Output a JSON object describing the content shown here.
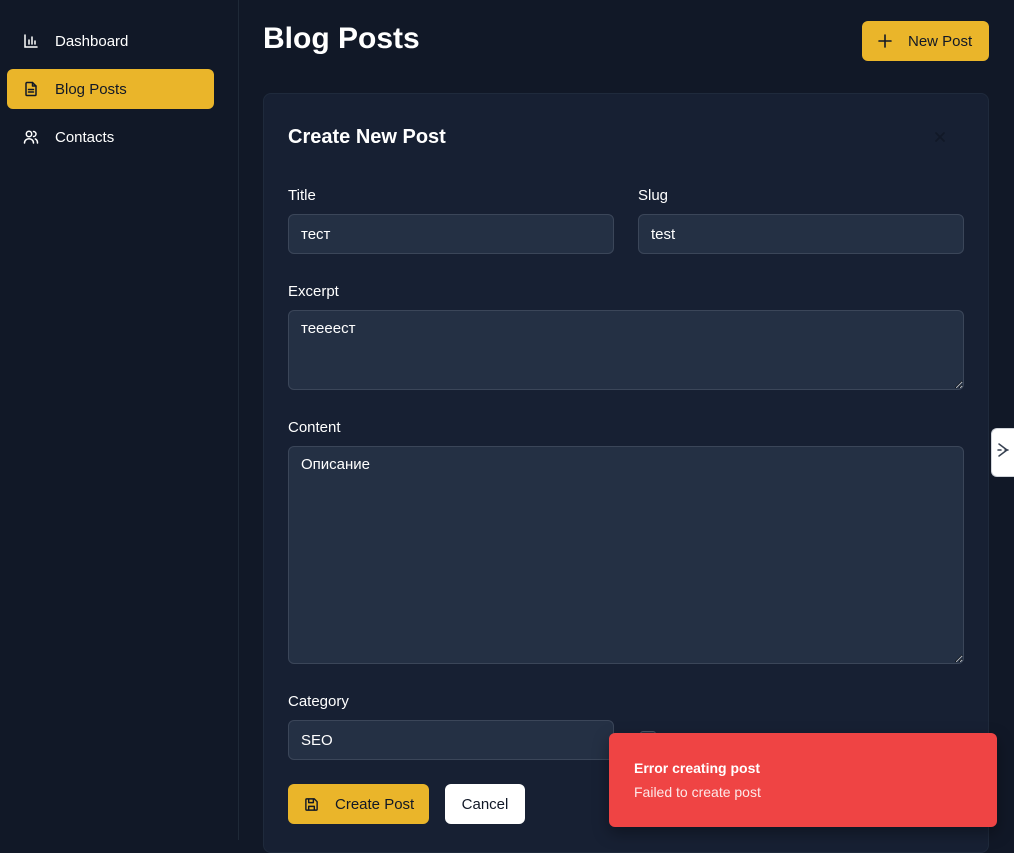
{
  "sidebar": {
    "items": [
      {
        "label": "Dashboard",
        "icon": "bar-chart-icon",
        "active": false
      },
      {
        "label": "Blog Posts",
        "icon": "file-text-icon",
        "active": true
      },
      {
        "label": "Contacts",
        "icon": "users-icon",
        "active": false
      }
    ]
  },
  "header": {
    "title": "Blog Posts",
    "new_post_label": "New Post"
  },
  "form": {
    "title": "Create New Post",
    "title_label": "Title",
    "title_value": "тест",
    "slug_label": "Slug",
    "slug_value": "test",
    "excerpt_label": "Excerpt",
    "excerpt_value": "тееeест",
    "content_label": "Content",
    "content_value": "Описание",
    "category_label": "Category",
    "category_value": "SEO",
    "create_label": "Create Post",
    "cancel_label": "Cancel"
  },
  "toast": {
    "title": "Error creating post",
    "description": "Failed to create post"
  },
  "colors": {
    "accent": "#eab52a",
    "background": "#111827",
    "card": "#172033",
    "input": "#243044",
    "error": "#ef4444"
  }
}
